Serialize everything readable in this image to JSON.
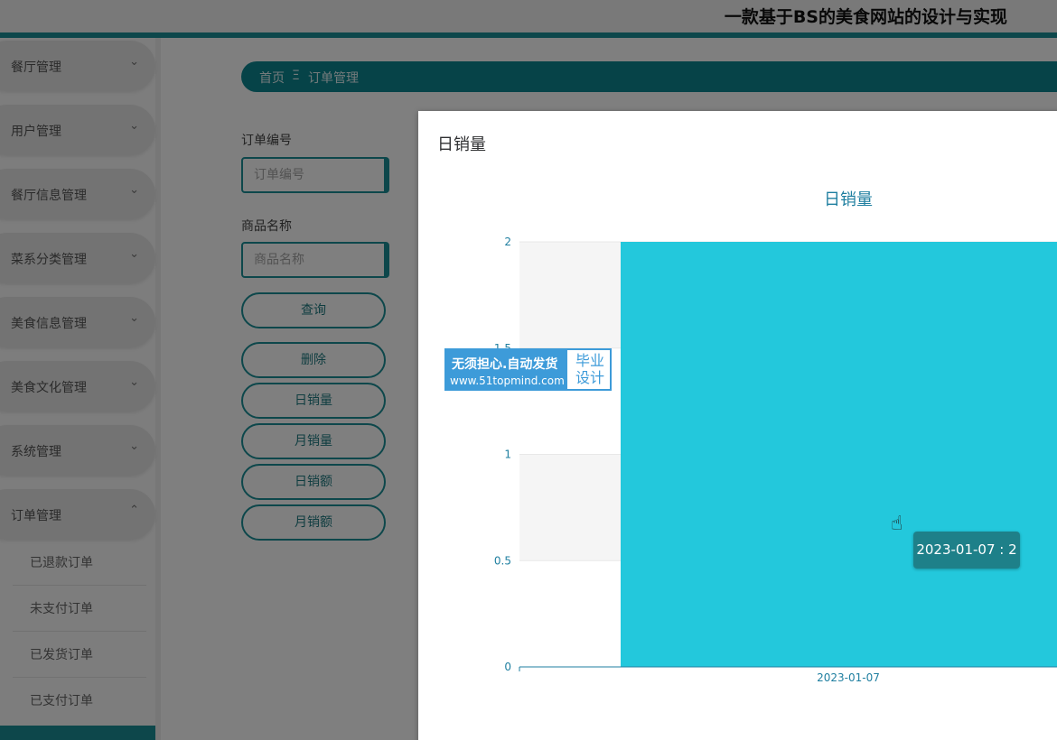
{
  "header": {
    "title": "一款基于BS的美食网站的设计与实现"
  },
  "sidebar": {
    "items": [
      {
        "label": "餐厅管理",
        "chevron": "⌄"
      },
      {
        "label": "用户管理",
        "chevron": "⌄"
      },
      {
        "label": "餐厅信息管理",
        "chevron": "⌄"
      },
      {
        "label": "菜系分类管理",
        "chevron": "⌄"
      },
      {
        "label": "美食信息管理",
        "chevron": "⌄"
      },
      {
        "label": "美食文化管理",
        "chevron": "⌄"
      },
      {
        "label": "系统管理",
        "chevron": "⌄"
      },
      {
        "label": "订单管理",
        "chevron": "⌃"
      }
    ],
    "sub_items": [
      {
        "label": "已退款订单"
      },
      {
        "label": "未支付订单"
      },
      {
        "label": "已发货订单"
      },
      {
        "label": "已支付订单"
      }
    ]
  },
  "breadcrumb": {
    "home": "首页",
    "separator": "Ξ",
    "current": "订单管理"
  },
  "form": {
    "order_no_label": "订单编号",
    "order_no_placeholder": "订单编号",
    "product_label": "商品名称",
    "product_placeholder": "商品名称"
  },
  "buttons": {
    "query": "查询",
    "delete": "删除",
    "daily_sales": "日销量",
    "monthly_sales": "月销量",
    "daily_revenue": "日销额",
    "monthly_revenue": "月销额"
  },
  "dialog": {
    "title": "日销量"
  },
  "watermark": {
    "line1": "无须担心.自动发货",
    "line2": "www.51topmind.com",
    "right": "毕业设计"
  },
  "tooltip": {
    "text": "2023-01-07 : 2"
  },
  "colors": {
    "accent": "#1a8f96",
    "bar": "#23c8dc",
    "axis": "#1f7fa0"
  },
  "chart_data": {
    "type": "bar",
    "title": "日销量",
    "categories": [
      "2023-01-07"
    ],
    "values": [
      2
    ],
    "ylim": [
      0,
      2
    ],
    "yticks": [
      0,
      0.5,
      1,
      1.5,
      2
    ],
    "xlabel": "",
    "ylabel": "",
    "grid": true
  }
}
